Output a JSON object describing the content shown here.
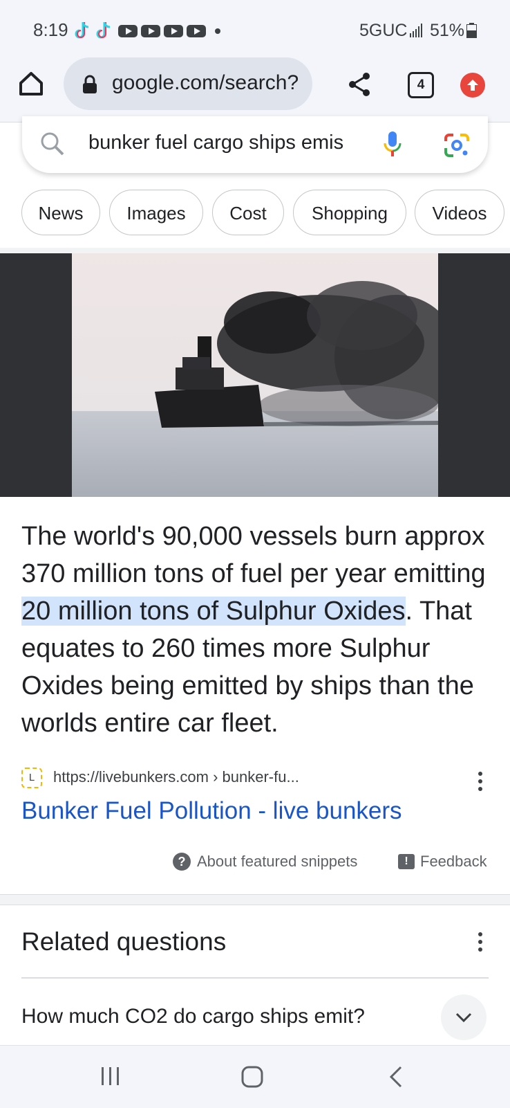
{
  "status_bar": {
    "time": "8:19",
    "network": "5GUC",
    "battery": "51%"
  },
  "browser": {
    "url": "google.com/search?",
    "tab_count": "4"
  },
  "search": {
    "query": "bunker fuel cargo ships emis"
  },
  "chips": [
    "News",
    "Images",
    "Cost",
    "Shopping",
    "Videos"
  ],
  "snippet": {
    "text_before": "The world's 90,000 vessels burn approx 370 million tons of fuel per year emitting ",
    "highlight": "20 million tons of Sulphur Oxides",
    "text_after": ". That equates to 260 times more Sulphur Oxides being emitted by ships than the worlds entire car fleet.",
    "source_url": "https://livebunkers.com › bunker-fu...",
    "source_title": "Bunker Fuel Pollution - live bunkers",
    "about_label": "About featured snippets",
    "feedback_label": "Feedback"
  },
  "related": {
    "title": "Related questions",
    "items": [
      "How much CO2 do cargo ships emit?"
    ]
  },
  "colors": {
    "link_blue": "#1a55c8",
    "highlight": "#d2e3fc",
    "chrome_bg": "#f3f5fb"
  }
}
